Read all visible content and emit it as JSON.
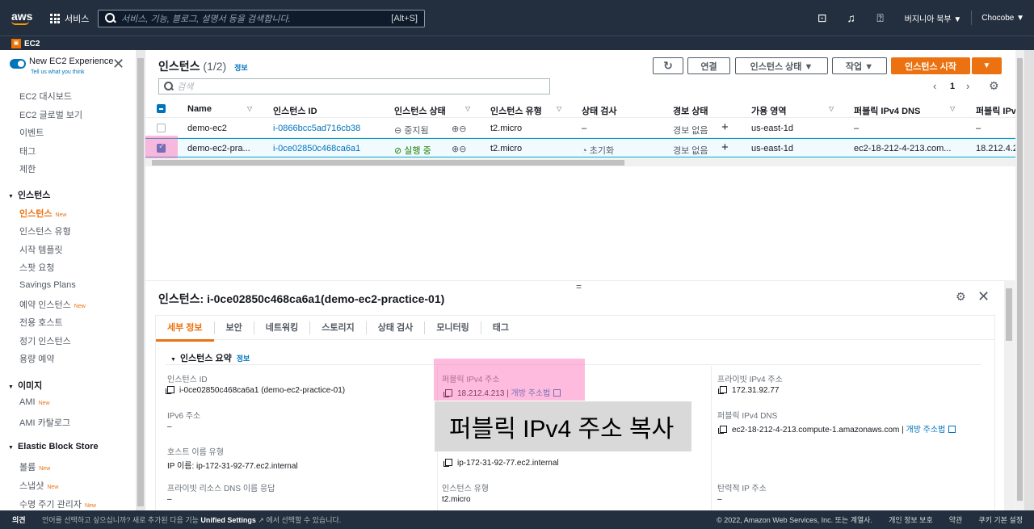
{
  "topnav": {
    "logo": "aws",
    "services_label": "서비스",
    "search_placeholder": "서비스, 기능, 블로그, 설명서 등을 검색합니다.",
    "search_shortcut": "[Alt+S]",
    "region": "버지니아 북부 ▼",
    "account": "Chocobe ▼"
  },
  "subnav": {
    "service": "EC2"
  },
  "sidebar": {
    "experience_title": "New EC2 Experience",
    "experience_sub": "Tell us what you think",
    "items": [
      {
        "label": "EC2 대시보드"
      },
      {
        "label": "EC2 글로벌 보기"
      },
      {
        "label": "이벤트"
      },
      {
        "label": "태그"
      },
      {
        "label": "제한"
      }
    ],
    "sections": [
      {
        "label": "인스턴스"
      },
      {
        "label": "이미지"
      },
      {
        "label": "Elastic Block Store"
      }
    ],
    "instances_items": [
      {
        "label": "인스턴스",
        "badge": "New"
      },
      {
        "label": "인스턴스 유형"
      },
      {
        "label": "시작 템플릿"
      },
      {
        "label": "스팟 요청"
      },
      {
        "label": "Savings Plans"
      },
      {
        "label": "예약 인스턴스",
        "badge": "New"
      },
      {
        "label": "전용 호스트"
      },
      {
        "label": "정기 인스턴스"
      },
      {
        "label": "용량 예약"
      }
    ],
    "images_items": [
      {
        "label": "AMI",
        "badge": "New"
      },
      {
        "label": "AMI 카탈로그"
      }
    ],
    "ebs_items": [
      {
        "label": "볼륨",
        "badge": "New"
      },
      {
        "label": "스냅샷",
        "badge": "New"
      },
      {
        "label": "수명 주기 관리자",
        "badge": "New"
      }
    ]
  },
  "main": {
    "title": "인스턴스",
    "count": "(1/2)",
    "info": "정보",
    "buttons": {
      "connect": "연결",
      "state": "인스턴스 상태 ▼",
      "actions": "작업 ▼",
      "launch": "인스턴스 시작",
      "launch_dropdown": "▼"
    },
    "search_placeholder": "검색",
    "page": "1",
    "columns": [
      "Name",
      "인스턴스 ID",
      "인스턴스 상태",
      "인스턴스 유형",
      "상태 검사",
      "경보 상태",
      "가용 영역",
      "퍼블릭 IPv4 DNS",
      "퍼블릭 IPv"
    ],
    "rows": [
      {
        "name": "demo-ec2",
        "id": "i-0866bcc5ad716cb38",
        "state": "중지됨",
        "type": "t2.micro",
        "check": "–",
        "alarm": "경보 없음",
        "az": "us-east-1d",
        "dns": "–",
        "ip": "–"
      },
      {
        "name": "demo-ec2-pra...",
        "id": "i-0ce02850c468ca6a1",
        "state": "실행 중",
        "type": "t2.micro",
        "check": "초기화",
        "alarm": "경보 없음",
        "az": "us-east-1d",
        "dns": "ec2-18-212-4-213.com...",
        "ip": "18.212.4.2"
      }
    ]
  },
  "detail": {
    "title": "인스턴스: i-0ce02850c468ca6a1(demo-ec2-practice-01)",
    "tabs": [
      "세부 정보",
      "보안",
      "네트워킹",
      "스토리지",
      "상태 검사",
      "모니터링",
      "태그"
    ],
    "section": "인스턴스 요약",
    "section_info": "정보",
    "fields": {
      "instance_id_label": "인스턴스 ID",
      "instance_id_value": "i-0ce02850c468ca6a1 (demo-ec2-practice-01)",
      "ipv6_label": "IPv6 주소",
      "ipv6_value": "–",
      "hostname_type_label": "호스트 이름 유형",
      "hostname_type_value": "IP 이름: ip-172-31-92-77.ec2.internal",
      "private_dns_label": "프라이빗 리소스 DNS 이름 응답",
      "private_dns_value": "–",
      "public_ipv4_label": "퍼블릭 IPv4 주소",
      "public_ipv4_value": "18.212.4.213 |",
      "open_address": "개방 주소법",
      "private_dns_name_value": "ip-172-31-92-77.ec2.internal",
      "instance_type_label": "인스턴스 유형",
      "instance_type_value": "t2.micro",
      "private_ipv4_label": "프라이빗 IPv4 주소",
      "private_ipv4_value": "172.31.92.77",
      "public_dns_label": "퍼블릭 IPv4 DNS",
      "public_dns_value": "ec2-18-212-4-213.compute-1.amazonaws.com |",
      "open_address2": "개방 주소법",
      "elastic_ip_label": "탄력적 IP 주소",
      "elastic_ip_value": "–"
    },
    "callout": "퍼블릭 IPv4 주소 복사"
  },
  "footer": {
    "feedback": "의견",
    "message_pre": "언어를 선택하고 싶으십니까? 새로 추가된 다음 기능 ",
    "message_link": "Unified Settings",
    "message_post": " 에서 선택할 수 있습니다.",
    "copyright": "© 2022, Amazon Web Services, Inc. 또는 계열사.",
    "privacy": "개인 정보 보호",
    "terms": "약관",
    "cookies": "쿠키 기본 설정"
  },
  "colors": {
    "accent": "#ec7211",
    "link": "#0073bb",
    "nav": "#232f3e",
    "highlight": "#ff69b4"
  }
}
